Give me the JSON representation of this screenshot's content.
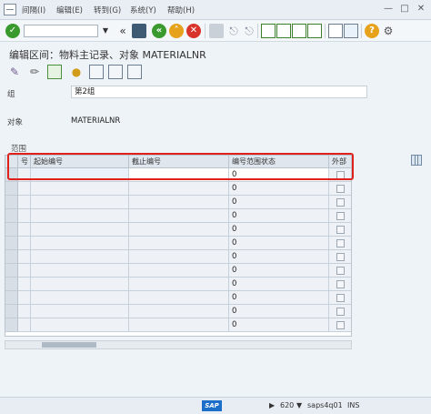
{
  "menu": {
    "items": [
      "间隔(I)",
      "编辑(E)",
      "转到(G)",
      "系统(Y)",
      "帮助(H)"
    ]
  },
  "toolbar": {
    "command_value": "",
    "icons": [
      "check-icon",
      "back-icon",
      "exit-icon",
      "cancel-icon",
      "print-icon",
      "find-icon",
      "find-next-icon",
      "first-page-icon",
      "prev-page-icon",
      "next-page-icon",
      "last-page-icon",
      "new-session-icon",
      "shortcut-icon",
      "help-icon",
      "settings-icon"
    ]
  },
  "title": "编辑区间：物料主记录、对象 MATERIALNR",
  "fields": {
    "group_label": "组",
    "group_value": "第2组",
    "object_label": "对象",
    "object_value": "MATERIALNR"
  },
  "range_section": {
    "title": "范围",
    "columns": [
      "号",
      "起始编号",
      "截止编号",
      "编号范围状态",
      "外部"
    ],
    "rows": [
      {
        "status": "0"
      },
      {
        "status": "0"
      },
      {
        "status": "0"
      },
      {
        "status": "0"
      },
      {
        "status": "0"
      },
      {
        "status": "0"
      },
      {
        "status": "0"
      },
      {
        "status": "0"
      },
      {
        "status": "0"
      },
      {
        "status": "0"
      },
      {
        "status": "0"
      },
      {
        "status": "0"
      }
    ]
  },
  "status": {
    "client": "620",
    "system": "saps4q01",
    "mode": "INS"
  },
  "colors": {
    "highlight": "#e0201b",
    "sap_blue": "#1b6fc8"
  }
}
